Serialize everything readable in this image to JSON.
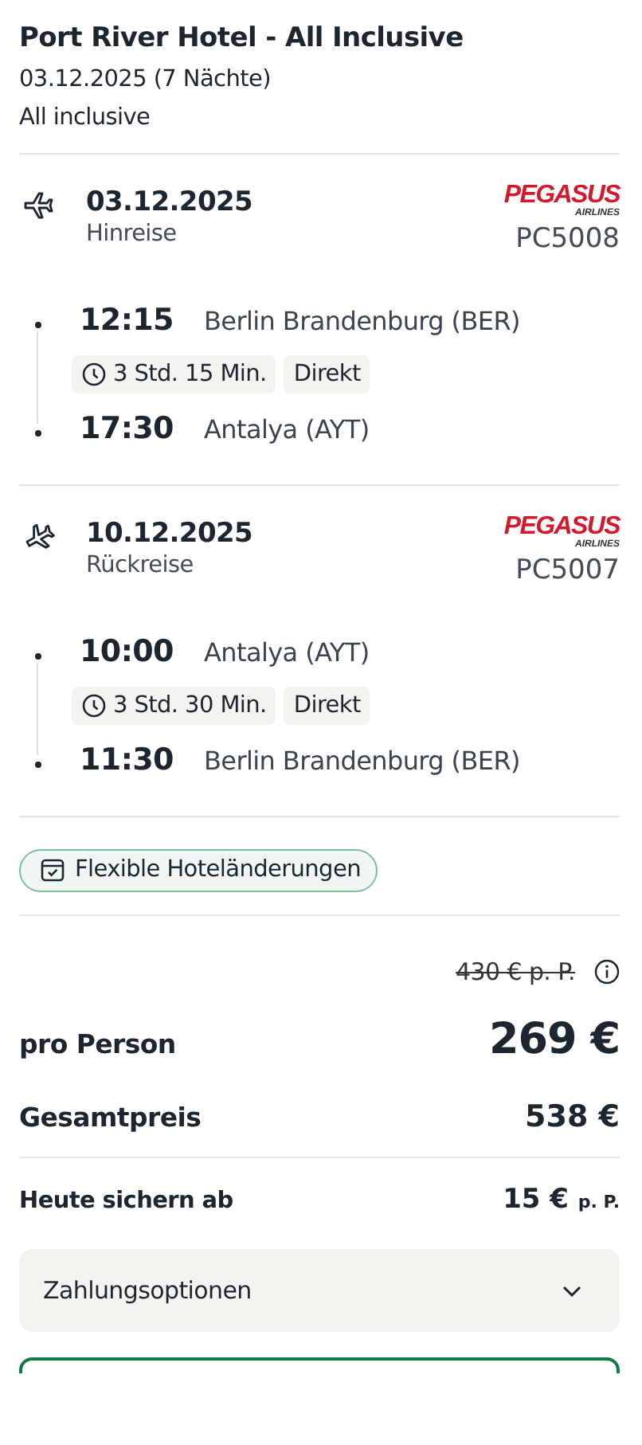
{
  "header": {
    "title": "Port River Hotel - All Inclusive",
    "dates": "03.12.2025 (7 Nächte)",
    "board": "All inclusive"
  },
  "flights": [
    {
      "kind": "outbound",
      "date": "03.12.2025",
      "label": "Hinreise",
      "airline_logo": "PEGASUS",
      "airline_logo_sub": "AIRLINES",
      "flight_number": "PC5008",
      "departure": {
        "time": "12:15",
        "place": "Berlin Brandenburg (BER)"
      },
      "duration": "3 Std. 15 Min.",
      "stops": "Direkt",
      "arrival": {
        "time": "17:30",
        "place": "Antalya (AYT)"
      }
    },
    {
      "kind": "return",
      "date": "10.12.2025",
      "label": "Rückreise",
      "airline_logo": "PEGASUS",
      "airline_logo_sub": "AIRLINES",
      "flight_number": "PC5007",
      "departure": {
        "time": "10:00",
        "place": "Antalya (AYT)"
      },
      "duration": "3 Std. 30 Min.",
      "stops": "Direkt",
      "arrival": {
        "time": "11:30",
        "place": "Berlin Brandenburg (BER)"
      }
    }
  ],
  "feature_tag": "Flexible Hoteländerungen",
  "prices": {
    "old_price": "430 € p. P.",
    "per_person_label": "pro Person",
    "per_person": "269 €",
    "total_label": "Gesamtpreis",
    "total": "538 €",
    "deposit_label": "Heute sichern ab",
    "deposit": "15 €",
    "deposit_unit": "p. P."
  },
  "payment_options": {
    "label": "Zahlungsoptionen",
    "expanded": false
  }
}
